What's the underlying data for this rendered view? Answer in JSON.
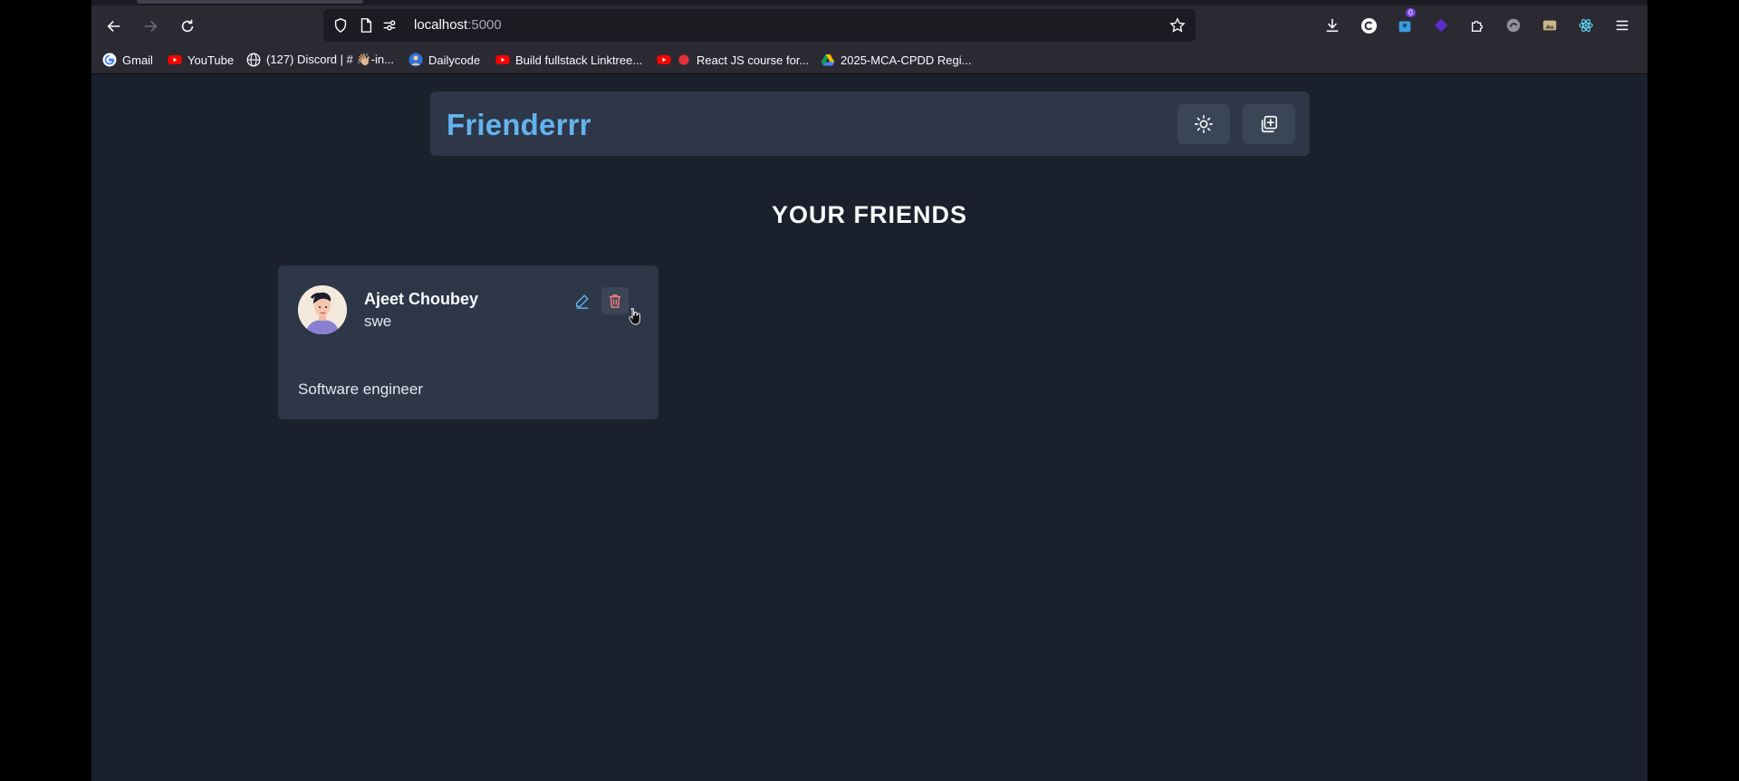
{
  "browser": {
    "url_host": "localhost",
    "url_port": ":5000",
    "extension_badge": "0",
    "bookmarks": [
      {
        "label": "Gmail",
        "icon": "google-icon"
      },
      {
        "label": "YouTube",
        "icon": "youtube-icon"
      },
      {
        "label": "(127) Discord | # 👋🏼-in...",
        "icon": "globe-icon"
      },
      {
        "label": "Dailycode",
        "icon": "dailycode-icon"
      },
      {
        "label": "Build fullstack Linktree...",
        "icon": "youtube-icon"
      },
      {
        "label": "React JS course for...",
        "icon": "youtube-icon"
      },
      {
        "label": "2025-MCA-CPDD Regi...",
        "icon": "drive-icon"
      }
    ]
  },
  "app": {
    "brand": "Frienderrr",
    "heading": "YOUR FRIENDS",
    "theme_icon": "sun-icon",
    "add_icon": "add-square-icon"
  },
  "friends": [
    {
      "name": "Ajeet Choubey",
      "role": "swe",
      "description": "Software engineer",
      "avatar": "avatar-illustration"
    }
  ],
  "colors": {
    "page_bg": "#1a202c",
    "panel_bg": "#2d3748",
    "brand": "#63b3ed",
    "edit_icon": "#63b3ed",
    "delete_icon": "#fc8181"
  }
}
